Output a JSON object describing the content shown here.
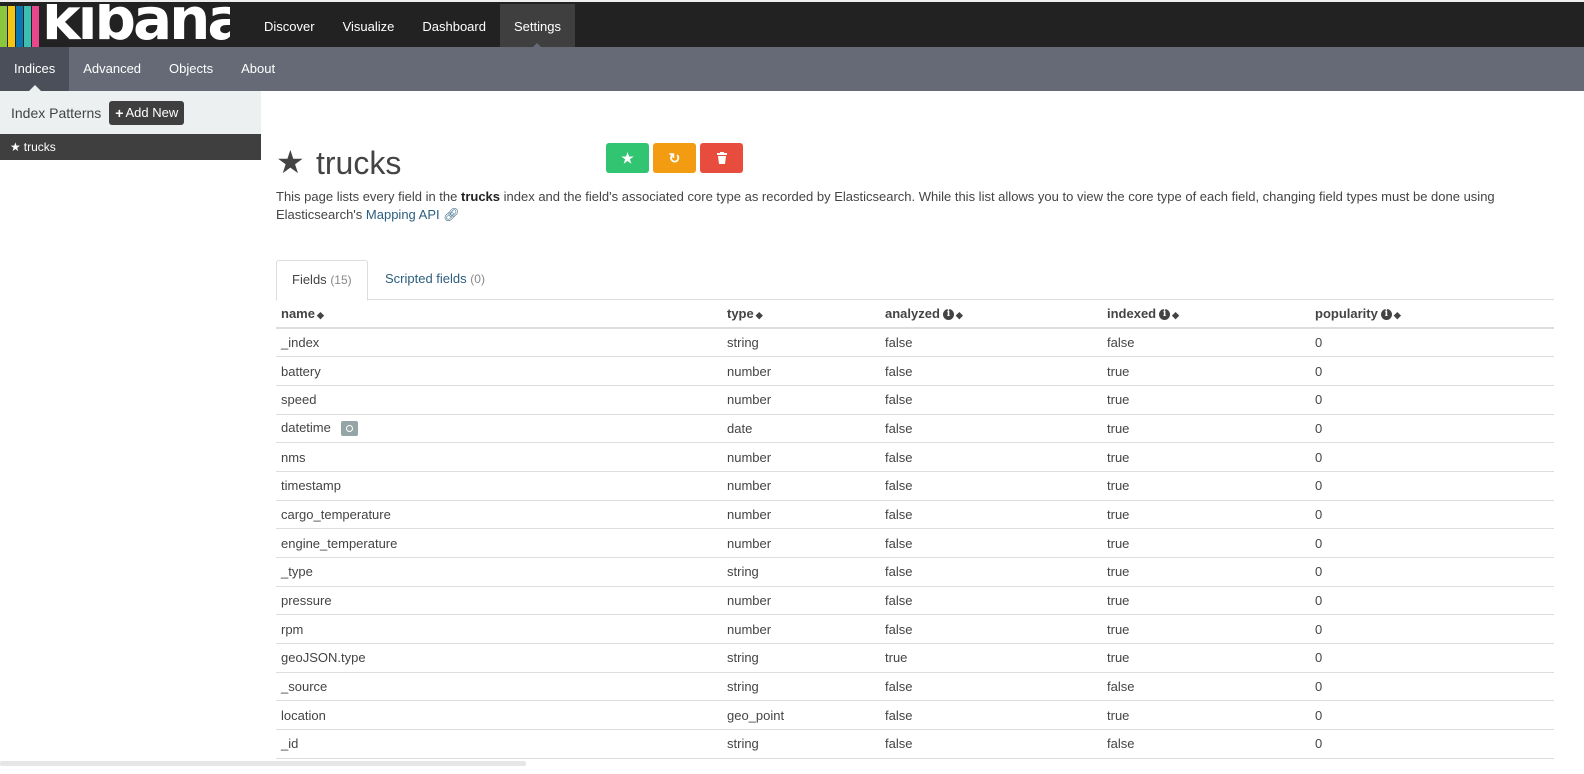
{
  "app": {
    "logo_text": "kibana",
    "logo_stripes": [
      "#e8488b",
      "#3cbeb1",
      "#8cc63f",
      "#f3c516",
      "#0a77b2"
    ]
  },
  "top_nav": [
    {
      "label": "Discover",
      "active": false
    },
    {
      "label": "Visualize",
      "active": false
    },
    {
      "label": "Dashboard",
      "active": false
    },
    {
      "label": "Settings",
      "active": true
    }
  ],
  "sub_nav": [
    {
      "label": "Indices",
      "active": true
    },
    {
      "label": "Advanced",
      "active": false
    },
    {
      "label": "Objects",
      "active": false
    },
    {
      "label": "About",
      "active": false
    }
  ],
  "sidebar": {
    "title": "Index Patterns",
    "add_button": "Add New",
    "items": [
      {
        "label": "trucks",
        "default": true
      }
    ]
  },
  "index": {
    "title": "trucks",
    "buttons": {
      "star_icon": "star-icon",
      "refresh_icon": "refresh-icon",
      "delete_icon": "trash-icon"
    },
    "description": {
      "part1": "This page lists every field in the ",
      "index_name": "trucks",
      "part2": " index and the field's associated core type as recorded by Elasticsearch. While this list allows you to view the core type of each field, changing field types must be done using Elasticsearch's ",
      "link": "Mapping API"
    }
  },
  "tabs": [
    {
      "label": "Fields",
      "count": "(15)",
      "active": true
    },
    {
      "label": "Scripted fields",
      "count": "(0)",
      "active": false
    }
  ],
  "table": {
    "columns": [
      "name",
      "type",
      "analyzed",
      "indexed",
      "popularity"
    ],
    "rows": [
      {
        "name": "_index",
        "type": "string",
        "analyzed": "false",
        "indexed": "false",
        "popularity": "0"
      },
      {
        "name": "battery",
        "type": "number",
        "analyzed": "false",
        "indexed": "true",
        "popularity": "0"
      },
      {
        "name": "speed",
        "type": "number",
        "analyzed": "false",
        "indexed": "true",
        "popularity": "0"
      },
      {
        "name": "datetime",
        "type": "date",
        "analyzed": "false",
        "indexed": "true",
        "popularity": "0",
        "time_field": true
      },
      {
        "name": "nms",
        "type": "number",
        "analyzed": "false",
        "indexed": "true",
        "popularity": "0"
      },
      {
        "name": "timestamp",
        "type": "number",
        "analyzed": "false",
        "indexed": "true",
        "popularity": "0"
      },
      {
        "name": "cargo_temperature",
        "type": "number",
        "analyzed": "false",
        "indexed": "true",
        "popularity": "0"
      },
      {
        "name": "engine_temperature",
        "type": "number",
        "analyzed": "false",
        "indexed": "true",
        "popularity": "0"
      },
      {
        "name": "_type",
        "type": "string",
        "analyzed": "false",
        "indexed": "true",
        "popularity": "0"
      },
      {
        "name": "pressure",
        "type": "number",
        "analyzed": "false",
        "indexed": "true",
        "popularity": "0"
      },
      {
        "name": "rpm",
        "type": "number",
        "analyzed": "false",
        "indexed": "true",
        "popularity": "0"
      },
      {
        "name": "geoJSON.type",
        "type": "string",
        "analyzed": "true",
        "indexed": "true",
        "popularity": "0"
      },
      {
        "name": "_source",
        "type": "string",
        "analyzed": "false",
        "indexed": "false",
        "popularity": "0"
      },
      {
        "name": "location",
        "type": "geo_point",
        "analyzed": "false",
        "indexed": "true",
        "popularity": "0"
      },
      {
        "name": "_id",
        "type": "string",
        "analyzed": "false",
        "indexed": "false",
        "popularity": "0"
      }
    ]
  }
}
